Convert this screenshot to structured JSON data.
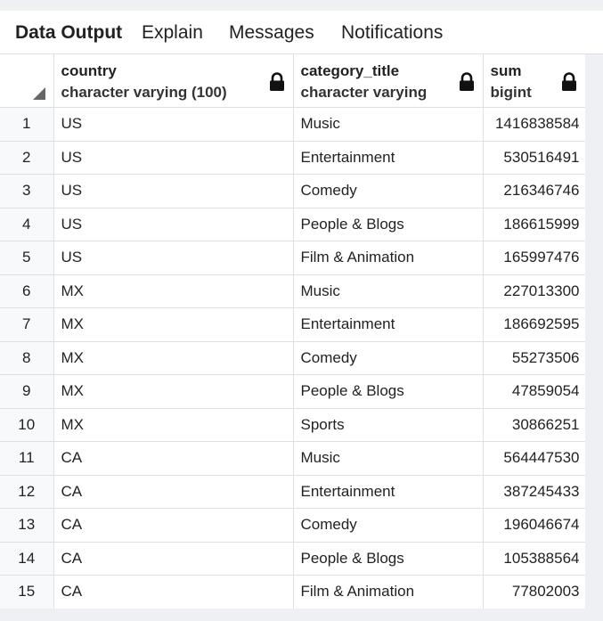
{
  "tabs": [
    {
      "label": "Data Output",
      "active": true
    },
    {
      "label": "Explain",
      "active": false
    },
    {
      "label": "Messages",
      "active": false
    },
    {
      "label": "Notifications",
      "active": false
    }
  ],
  "columns": [
    {
      "name": "country",
      "type": "character varying (100)",
      "icon": "lock-icon"
    },
    {
      "name": "category_title",
      "type": "character varying",
      "icon": "lock-icon"
    },
    {
      "name": "sum",
      "type": "bigint",
      "icon": "lock-icon"
    }
  ],
  "rows": [
    {
      "n": "1",
      "country": "US",
      "category_title": "Music",
      "sum": "1416838584"
    },
    {
      "n": "2",
      "country": "US",
      "category_title": "Entertainment",
      "sum": "530516491"
    },
    {
      "n": "3",
      "country": "US",
      "category_title": "Comedy",
      "sum": "216346746"
    },
    {
      "n": "4",
      "country": "US",
      "category_title": "People & Blogs",
      "sum": "186615999"
    },
    {
      "n": "5",
      "country": "US",
      "category_title": "Film & Animation",
      "sum": "165997476"
    },
    {
      "n": "6",
      "country": "MX",
      "category_title": "Music",
      "sum": "227013300"
    },
    {
      "n": "7",
      "country": "MX",
      "category_title": "Entertainment",
      "sum": "186692595"
    },
    {
      "n": "8",
      "country": "MX",
      "category_title": "Comedy",
      "sum": "55273506"
    },
    {
      "n": "9",
      "country": "MX",
      "category_title": "People & Blogs",
      "sum": "47859054"
    },
    {
      "n": "10",
      "country": "MX",
      "category_title": "Sports",
      "sum": "30866251"
    },
    {
      "n": "11",
      "country": "CA",
      "category_title": "Music",
      "sum": "564447530"
    },
    {
      "n": "12",
      "country": "CA",
      "category_title": "Entertainment",
      "sum": "387245433"
    },
    {
      "n": "13",
      "country": "CA",
      "category_title": "Comedy",
      "sum": "196046674"
    },
    {
      "n": "14",
      "country": "CA",
      "category_title": "People & Blogs",
      "sum": "105388564"
    },
    {
      "n": "15",
      "country": "CA",
      "category_title": "Film & Animation",
      "sum": "77802003"
    }
  ]
}
